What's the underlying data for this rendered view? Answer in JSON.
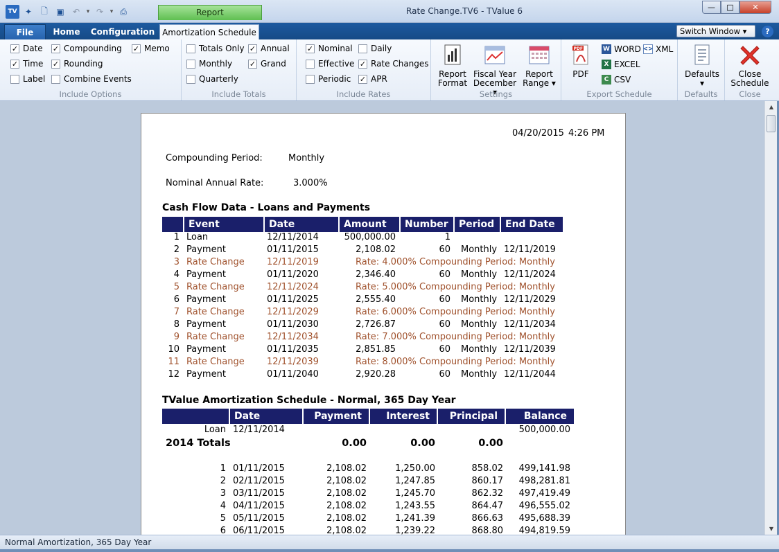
{
  "window": {
    "title": "Rate Change.TV6 - TValue 6",
    "context_tab": "Report",
    "controls": {
      "minimize": "—",
      "maximize": "□",
      "close": "✕"
    }
  },
  "tabs": {
    "file": "File",
    "home": "Home",
    "configuration": "Configuration",
    "amortization": "Amortization Schedule",
    "switch_window": "Switch Window ▾",
    "help": "?"
  },
  "ribbon": {
    "include_options": {
      "label": "Include Options",
      "items": [
        {
          "label": "Date",
          "checked": true
        },
        {
          "label": "Time",
          "checked": true
        },
        {
          "label": "Label",
          "checked": false
        },
        {
          "label": "Compounding",
          "checked": true
        },
        {
          "label": "Rounding",
          "checked": true
        },
        {
          "label": "Combine Events",
          "checked": false
        },
        {
          "label": "Memo",
          "checked": true
        }
      ]
    },
    "include_totals": {
      "label": "Include Totals",
      "items": [
        {
          "label": "Totals Only",
          "checked": false
        },
        {
          "label": "Monthly",
          "checked": false
        },
        {
          "label": "Quarterly",
          "checked": false
        },
        {
          "label": "Annual",
          "checked": true
        },
        {
          "label": "Grand",
          "checked": true
        }
      ]
    },
    "include_rates": {
      "label": "Include Rates",
      "items": [
        {
          "label": "Nominal",
          "checked": true
        },
        {
          "label": "Effective",
          "checked": false
        },
        {
          "label": "Periodic",
          "checked": false
        },
        {
          "label": "Daily",
          "checked": false
        },
        {
          "label": "Rate Changes",
          "checked": true
        },
        {
          "label": "APR",
          "checked": true
        }
      ]
    },
    "settings": {
      "label": "Settings",
      "report_format": [
        "Report",
        "Format"
      ],
      "fiscal_year": [
        "Fiscal Year",
        "December ▾"
      ],
      "report_range": [
        "Report",
        "Range ▾"
      ]
    },
    "export": {
      "label": "Export Schedule",
      "pdf": "PDF",
      "word": "WORD",
      "excel": "EXCEL",
      "csv": "CSV",
      "xml": "XML"
    },
    "defaults": {
      "label": "Defaults",
      "button": "Defaults",
      "arrow": "▾"
    },
    "close": {
      "label": "Close",
      "button": [
        "Close",
        "Schedule"
      ]
    }
  },
  "report": {
    "date": "04/20/2015",
    "time": "4:26 PM",
    "compounding_label": "Compounding Period:",
    "compounding_value": "Monthly",
    "rate_label": "Nominal Annual Rate:",
    "rate_value": "3.000%",
    "cashflow_title": "Cash Flow Data - Loans and Payments",
    "cashflow_headers": [
      "Event",
      "Date",
      "Amount",
      "Number",
      "Period",
      "End Date"
    ],
    "cashflow_rows": [
      {
        "n": "1",
        "event": "Loan",
        "date": "12/11/2014",
        "amount": "500,000.00",
        "number": "1",
        "period": "",
        "end": "",
        "rc": false
      },
      {
        "n": "2",
        "event": "Payment",
        "date": "01/11/2015",
        "amount": "2,108.02",
        "number": "60",
        "period": "Monthly",
        "end": "12/11/2019",
        "rc": false
      },
      {
        "n": "3",
        "event": "Rate Change",
        "date": "12/11/2019",
        "note": "Rate: 4.000% Compounding Period: Monthly",
        "rc": true
      },
      {
        "n": "4",
        "event": "Payment",
        "date": "01/11/2020",
        "amount": "2,346.40",
        "number": "60",
        "period": "Monthly",
        "end": "12/11/2024",
        "rc": false
      },
      {
        "n": "5",
        "event": "Rate Change",
        "date": "12/11/2024",
        "note": "Rate: 5.000% Compounding Period: Monthly",
        "rc": true
      },
      {
        "n": "6",
        "event": "Payment",
        "date": "01/11/2025",
        "amount": "2,555.40",
        "number": "60",
        "period": "Monthly",
        "end": "12/11/2029",
        "rc": false
      },
      {
        "n": "7",
        "event": "Rate Change",
        "date": "12/11/2029",
        "note": "Rate: 6.000% Compounding Period: Monthly",
        "rc": true
      },
      {
        "n": "8",
        "event": "Payment",
        "date": "01/11/2030",
        "amount": "2,726.87",
        "number": "60",
        "period": "Monthly",
        "end": "12/11/2034",
        "rc": false
      },
      {
        "n": "9",
        "event": "Rate Change",
        "date": "12/11/2034",
        "note": "Rate: 7.000% Compounding Period: Monthly",
        "rc": true
      },
      {
        "n": "10",
        "event": "Payment",
        "date": "01/11/2035",
        "amount": "2,851.85",
        "number": "60",
        "period": "Monthly",
        "end": "12/11/2039",
        "rc": false
      },
      {
        "n": "11",
        "event": "Rate Change",
        "date": "12/11/2039",
        "note": "Rate: 8.000% Compounding Period: Monthly",
        "rc": true
      },
      {
        "n": "12",
        "event": "Payment",
        "date": "01/11/2040",
        "amount": "2,920.28",
        "number": "60",
        "period": "Monthly",
        "end": "12/11/2044",
        "rc": false
      }
    ],
    "amort_title": "TValue Amortization Schedule - Normal, 365 Day Year",
    "amort_headers": [
      "Date",
      "Payment",
      "Interest",
      "Principal",
      "Balance"
    ],
    "loan_row": {
      "label": "Loan",
      "date": "12/11/2014",
      "balance": "500,000.00"
    },
    "totals_row": {
      "label": "2014 Totals",
      "payment": "0.00",
      "interest": "0.00",
      "principal": "0.00"
    },
    "amort_rows": [
      {
        "n": "1",
        "date": "01/11/2015",
        "payment": "2,108.02",
        "interest": "1,250.00",
        "principal": "858.02",
        "balance": "499,141.98"
      },
      {
        "n": "2",
        "date": "02/11/2015",
        "payment": "2,108.02",
        "interest": "1,247.85",
        "principal": "860.17",
        "balance": "498,281.81"
      },
      {
        "n": "3",
        "date": "03/11/2015",
        "payment": "2,108.02",
        "interest": "1,245.70",
        "principal": "862.32",
        "balance": "497,419.49"
      },
      {
        "n": "4",
        "date": "04/11/2015",
        "payment": "2,108.02",
        "interest": "1,243.55",
        "principal": "864.47",
        "balance": "496,555.02"
      },
      {
        "n": "5",
        "date": "05/11/2015",
        "payment": "2,108.02",
        "interest": "1,241.39",
        "principal": "866.63",
        "balance": "495,688.39"
      },
      {
        "n": "6",
        "date": "06/11/2015",
        "payment": "2,108.02",
        "interest": "1,239.22",
        "principal": "868.80",
        "balance": "494,819.59"
      }
    ]
  },
  "status": "Normal Amortization, 365 Day Year",
  "colors": {
    "table_header": "#1a1f6a",
    "rate_change": "#a0522d",
    "tab_bar": "#1d5aa0"
  }
}
